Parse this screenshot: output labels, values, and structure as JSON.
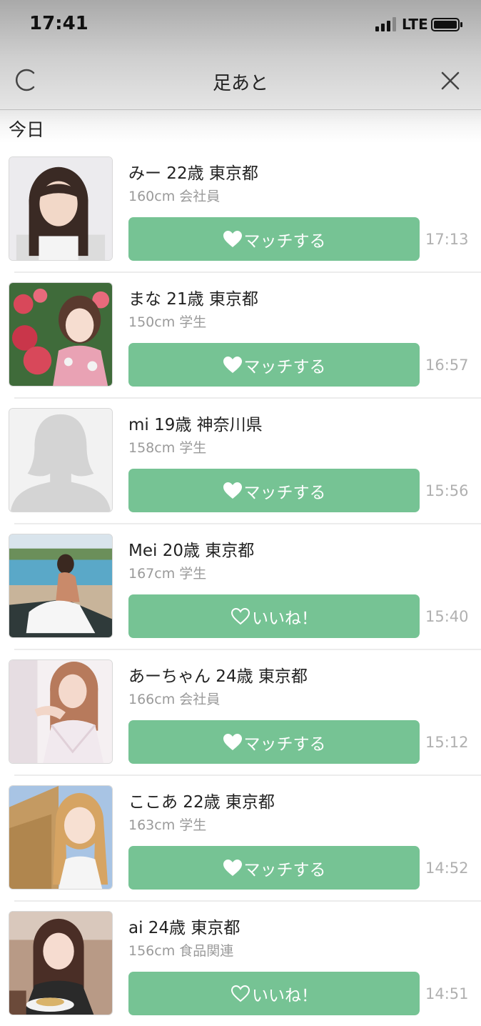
{
  "status_bar": {
    "time": "17:41",
    "network": "LTE"
  },
  "nav": {
    "title": "足あと",
    "left_icon": "refresh-icon",
    "right_icon": "close-icon"
  },
  "section": {
    "header": "今日"
  },
  "colors": {
    "button": "#76c394",
    "time_text": "#b0b0b0",
    "detail_text": "#9a9a9a"
  },
  "footprints": [
    {
      "name": "みー 22歳 東京都",
      "detail": "160cm 会社員",
      "button": "マッチする",
      "button_icon": "heart-filled-icon",
      "time": "17:13"
    },
    {
      "name": "まな 21歳 東京都",
      "detail": "150cm 学生",
      "button": "マッチする",
      "button_icon": "heart-filled-icon",
      "time": "16:57"
    },
    {
      "name": "mi 19歳 神奈川県",
      "detail": "158cm 学生",
      "button": "マッチする",
      "button_icon": "heart-filled-icon",
      "time": "15:56"
    },
    {
      "name": "Mei 20歳 東京都",
      "detail": "167cm 学生",
      "button": "いいね！",
      "button_icon": "heart-outline-icon",
      "time": "15:40"
    },
    {
      "name": "あーちゃん 24歳 東京都",
      "detail": "166cm 会社員",
      "button": "マッチする",
      "button_icon": "heart-filled-icon",
      "time": "15:12"
    },
    {
      "name": "ここあ 22歳 東京都",
      "detail": "163cm 学生",
      "button": "マッチする",
      "button_icon": "heart-filled-icon",
      "time": "14:52"
    },
    {
      "name": "ai 24歳 東京都",
      "detail": "156cm 食品関連",
      "button": "いいね！",
      "button_icon": "heart-outline-icon",
      "time": "14:51"
    }
  ]
}
